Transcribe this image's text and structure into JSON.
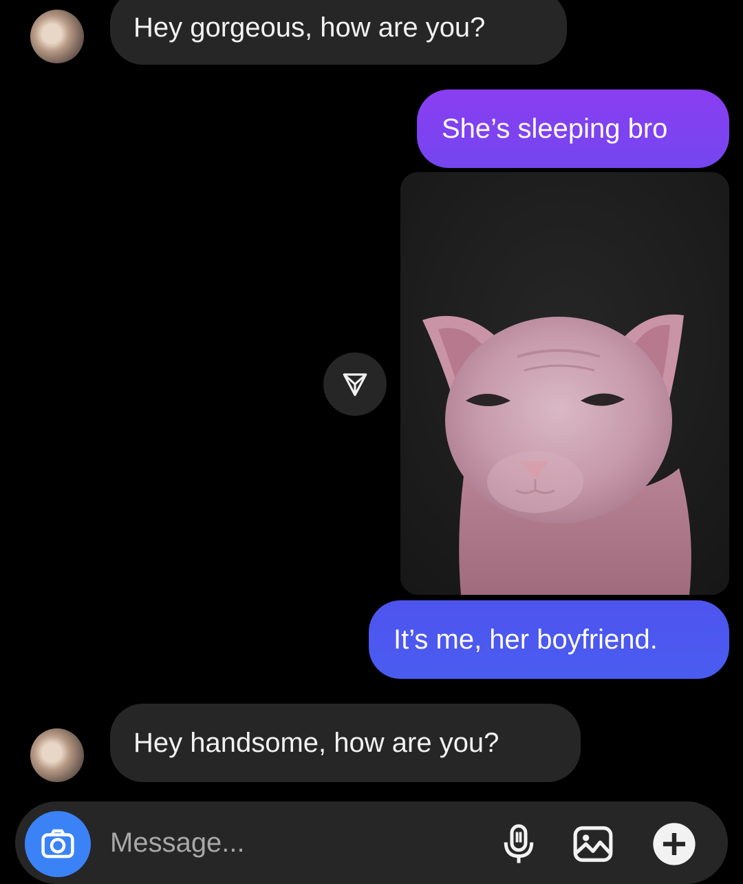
{
  "colors": {
    "background": "#000000",
    "incoming_bubble": "#262626",
    "outgoing_gradient_top": "#8b3ff0",
    "outgoing_gradient_bottom": "#4a5cf0",
    "camera_button": "#3b82f6"
  },
  "conversation": {
    "messages": [
      {
        "sender": "other",
        "type": "text",
        "text": "Hey gorgeous, how are you?"
      },
      {
        "sender": "me",
        "type": "text",
        "text": "She’s sleeping bro"
      },
      {
        "sender": "me",
        "type": "image",
        "content": "hairless-sphynx-cat-photo"
      },
      {
        "sender": "me",
        "type": "text",
        "text": "It’s me, her boyfriend."
      },
      {
        "sender": "other",
        "type": "text",
        "text": "Hey handsome, how are you?"
      }
    ]
  },
  "composer": {
    "placeholder": "Message...",
    "icons": [
      "camera-icon",
      "microphone-icon",
      "gallery-icon",
      "plus-icon"
    ]
  }
}
